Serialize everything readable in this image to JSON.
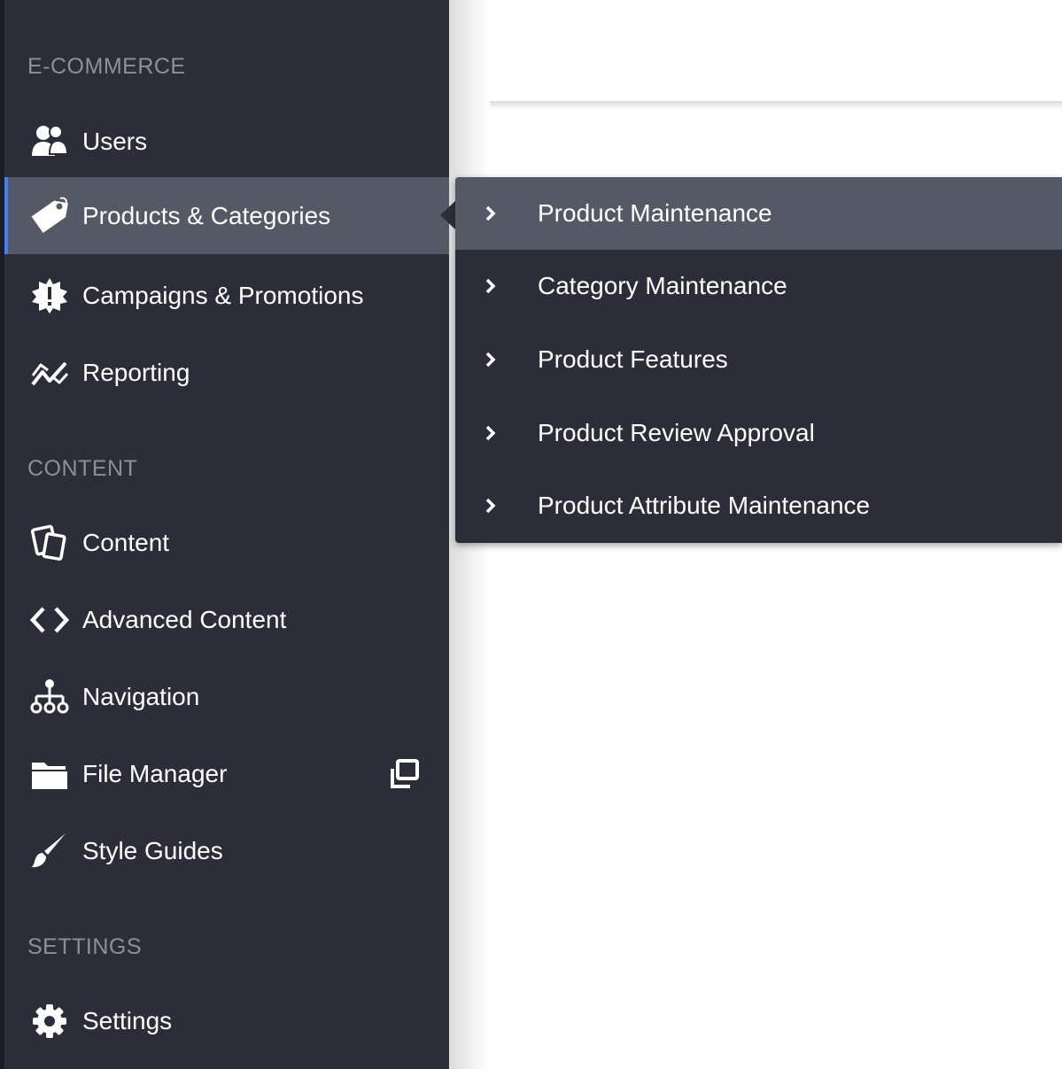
{
  "sidebar": {
    "sections": [
      {
        "label": "E-COMMERCE",
        "items": [
          {
            "label": "Users",
            "icon": "users-icon"
          },
          {
            "label": "Products & Categories",
            "icon": "tag-icon",
            "active": true
          },
          {
            "label": "Campaigns & Promotions",
            "icon": "badge-icon"
          },
          {
            "label": "Reporting",
            "icon": "chart-line-icon"
          }
        ]
      },
      {
        "label": "CONTENT",
        "items": [
          {
            "label": "Content",
            "icon": "documents-icon"
          },
          {
            "label": "Advanced Content",
            "icon": "code-icon"
          },
          {
            "label": "Navigation",
            "icon": "sitemap-icon"
          },
          {
            "label": "File Manager",
            "icon": "folder-icon",
            "external_icon": "external-window-icon"
          },
          {
            "label": "Style Guides",
            "icon": "brush-icon"
          }
        ]
      },
      {
        "label": "SETTINGS",
        "items": [
          {
            "label": "Settings",
            "icon": "gear-icon"
          }
        ]
      }
    ]
  },
  "flyout": {
    "items": [
      {
        "label": "Product Maintenance",
        "active": true
      },
      {
        "label": "Category Maintenance"
      },
      {
        "label": "Product Features"
      },
      {
        "label": "Product Review Approval"
      },
      {
        "label": "Product Attribute Maintenance"
      }
    ]
  },
  "colors": {
    "sidebar_bg": "#2b2e39",
    "active_bg": "#555966",
    "accent": "#3b82f6",
    "section_label": "#8c909a",
    "text": "#ffffff"
  }
}
